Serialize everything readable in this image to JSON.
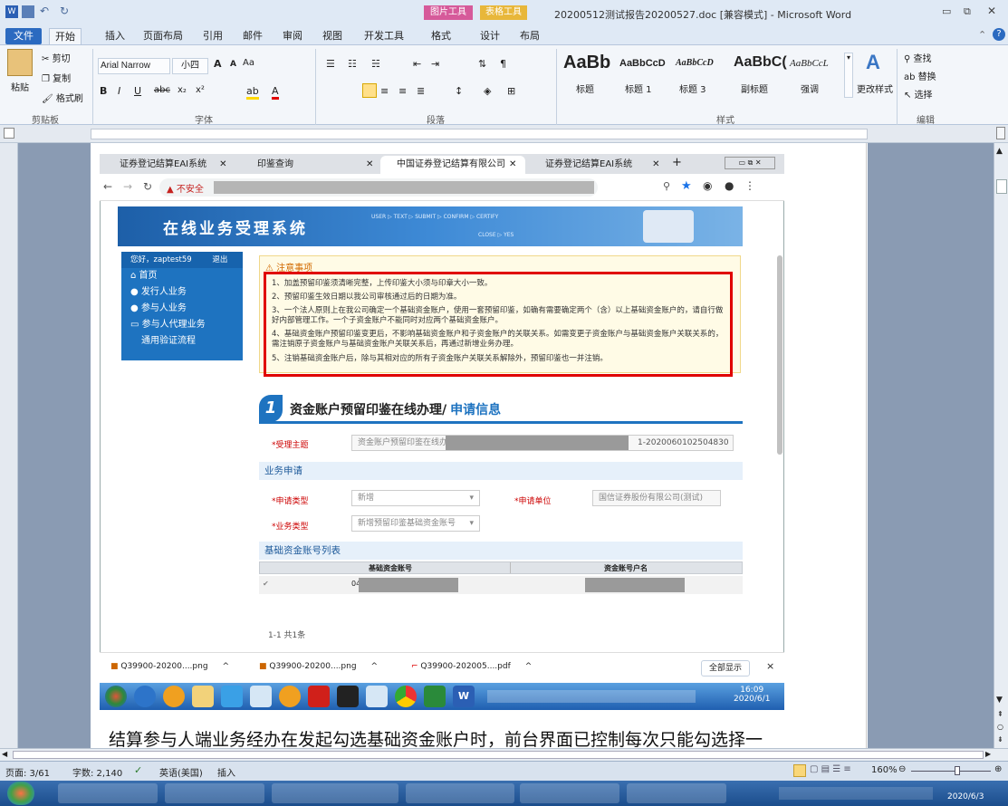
{
  "window": {
    "title": "20200512测试报告20200527.doc [兼容模式] - Microsoft Word",
    "context_tab1": "图片工具",
    "context_tab2": "表格工具"
  },
  "ribbon_tabs": [
    "文件",
    "开始",
    "插入",
    "页面布局",
    "引用",
    "邮件",
    "审阅",
    "视图",
    "开发工具",
    "格式",
    "设计",
    "布局"
  ],
  "clipboard": {
    "paste": "粘贴",
    "cut": "剪切",
    "copy": "复制",
    "format_painter": "格式刷",
    "group": "剪贴板"
  },
  "font": {
    "name": "Arial Narrow",
    "size": "小四",
    "group": "字体"
  },
  "paragraph": {
    "group": "段落"
  },
  "styles": {
    "items": [
      {
        "preview": "AaBb",
        "name": "标题"
      },
      {
        "preview": "AaBbCcD",
        "name": "标题 1"
      },
      {
        "preview": "AaBbCcD",
        "name": "标题 3"
      },
      {
        "preview": "AaBbC(",
        "name": "副标题"
      },
      {
        "preview": "AaBbCcL",
        "name": "强调"
      }
    ],
    "change": "更改样式",
    "group": "样式"
  },
  "editing": {
    "find": "查找",
    "replace": "替换",
    "select": "选择",
    "group": "编辑"
  },
  "browser": {
    "tabs": [
      "证券登记结算EAI系统",
      "印鉴查询",
      "中国证券登记结算有限公司",
      "证券登记结算EAI系统"
    ],
    "insecure": "不安全",
    "new_tab": "+"
  },
  "site": {
    "banner_title": "在线业务受理系统",
    "banner_steps": [
      "USER",
      "TEXT",
      "SUBMIT",
      "CONFIRM",
      "CERTIFY",
      "CLOSE",
      "YES"
    ],
    "user": "您好，zaptest59",
    "logout": "退出",
    "menu": [
      "首页",
      "发行人业务",
      "参与人业务",
      "参与人代理业务",
      "通用验证流程"
    ],
    "notice_title": "注意事项",
    "notices": [
      "1、加盖预留印鉴须清晰完整，上传印鉴大小须与印章大小一致。",
      "2、预留印鉴生效日期以我公司审核通过后的日期为准。",
      "3、一个法人原则上在我公司确定一个基础资金账户，使用一套预留印鉴，如确有需要确定两个（含）以上基础资金账户的，请自行做好内部管理工作。一个子资金账户不能同时对应两个基础资金账户。",
      "4、基础资金账户预留印鉴变更后，不影响基础资金账户和子资金账户的关联关系。如需变更子资金账户与基础资金账户关联关系的，需注销原子资金账户与基础资金账户关联关系后，再通过新增业务办理。",
      "5、注销基础资金账户后，除与其相对应的所有子资金账户关联关系解除外，预留印鉴也一并注销。"
    ],
    "form_step": "1",
    "form_title": "资金账户预留印鉴在线办理/",
    "form_title_sub": "申请信息",
    "subject_label": "*受理主题",
    "subject_prefix": "资金账户预留印鉴在线办",
    "subject_suffix": "1-2020060102504830",
    "section_apply": "业务申请",
    "apply_type_label": "*申请类型",
    "apply_type_value": "新增",
    "apply_unit_label": "*申请单位",
    "apply_unit_value": "国信证券股份有限公司(测试)",
    "biz_type_label": "*业务类型",
    "biz_type_value": "新增预留印鉴基础资金账号",
    "section_list": "基础资金账号列表",
    "col1": "基础资金账号",
    "col2": "资金账号户名",
    "row1_acct": "04(",
    "pager": "1-1  共1条"
  },
  "downloads": {
    "files": [
      "Q39900-20200....png",
      "Q39900-20200....png",
      "Q39900-202005....pdf"
    ],
    "show_all": "全部显示",
    "close": "×"
  },
  "inner_clock": {
    "time": "16:09",
    "date": "2020/6/1"
  },
  "doc_text": "结算参与人端业务经办在发起勾选基础资金账户时，前台界面已控制每次只能勾选择一",
  "status": {
    "page": "页面: 3/61",
    "words": "字数: 2,140",
    "lang": "英语(美国)",
    "mode": "插入",
    "zoom": "160%"
  },
  "taskbar": {
    "date": "2020/6/3"
  }
}
